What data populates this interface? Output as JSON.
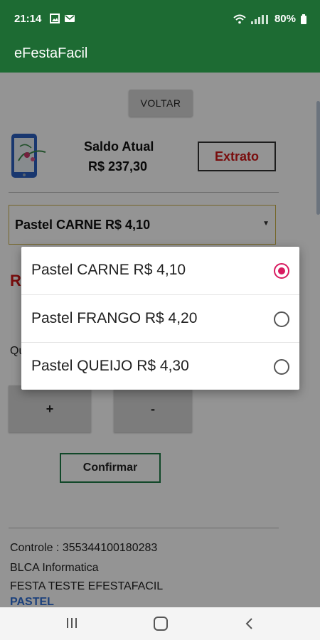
{
  "status_bar": {
    "time": "21:14",
    "battery": "80%",
    "left_icons": [
      "gallery-icon",
      "message-icon"
    ],
    "right_icons": [
      "wifi-icon",
      "signal-icon",
      "battery-icon"
    ]
  },
  "app": {
    "title": "eFestaFacil",
    "primary_color": "#1d6b33"
  },
  "screen": {
    "back_button": "VOLTAR",
    "balance_label": "Saldo Atual",
    "balance_value": "R$  237,30",
    "statement_button": "Extrato",
    "selected_product": "Pastel CARNE R$ 4,10",
    "red_partial_text": "R",
    "quantity_partial_text": "Qu",
    "plus_button": "+",
    "minus_button": "-",
    "confirm_button": "Confirmar",
    "footer": {
      "controle": "Controle : 355344100180283",
      "company": "BLCA Informatica",
      "event": "FESTA TESTE EFESTAFACIL",
      "category": "PASTEL"
    }
  },
  "dialog": {
    "options": [
      {
        "label": "Pastel CARNE R$ 4,10",
        "selected": true
      },
      {
        "label": "Pastel FRANGO R$ 4,20",
        "selected": false
      },
      {
        "label": "Pastel QUEIJO R$ 4,30",
        "selected": false
      }
    ],
    "accent_color": "#d81b60"
  },
  "nav_bar": {
    "icons": [
      "recents-icon",
      "home-icon",
      "back-icon"
    ]
  }
}
